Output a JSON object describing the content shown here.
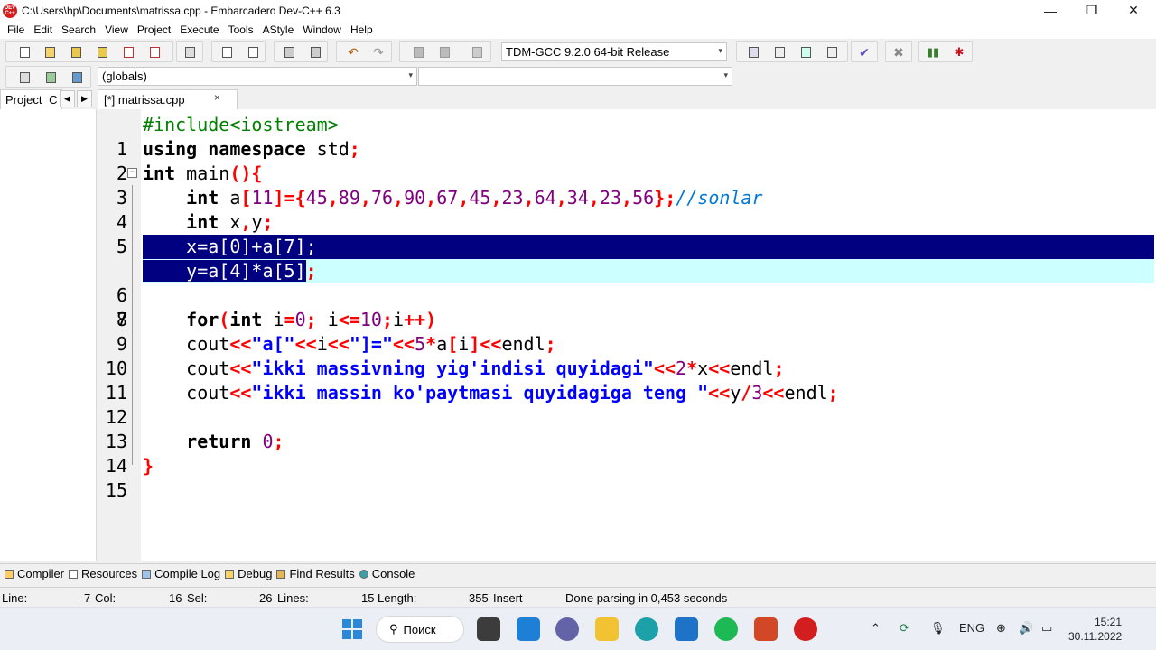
{
  "window": {
    "title": "C:\\Users\\hp\\Documents\\matrissa.cpp - Embarcadero Dev-C++ 6.3",
    "icon_text": "DEV C++",
    "controls": [
      "—",
      "❐",
      "✕"
    ]
  },
  "menu": [
    "File",
    "Edit",
    "Search",
    "View",
    "Project",
    "Execute",
    "Tools",
    "AStyle",
    "Window",
    "Help"
  ],
  "toolbar": {
    "compiler_select": "TDM-GCC 9.2.0 64-bit Release",
    "scope_select": "(globals)",
    "member_select": ""
  },
  "panel": {
    "project_tab": "Project",
    "project_tab_more": "C",
    "file_tab": "[*] matrissa.cpp",
    "close_glyph": "×"
  },
  "editor": {
    "line_numbers": [
      "1",
      "2",
      "3",
      "4",
      "5",
      "6",
      "7",
      "8",
      "9",
      "10",
      "11",
      "12",
      "13",
      "14",
      "15"
    ],
    "fold_glyph": "−"
  },
  "bottom_tabs": [
    "Compiler",
    "Resources",
    "Compile Log",
    "Debug",
    "Find Results",
    "Console"
  ],
  "status": {
    "line_label": "Line:",
    "line_value": "7",
    "col_label": "Col:",
    "col_value": "16",
    "sel_label": "Sel:",
    "sel_value": "26",
    "lines_label": "Lines:",
    "lines_value": "15",
    "length_label": "Length:",
    "length_value": "355",
    "mode": "Insert",
    "message": "Done parsing in 0,453 seconds"
  },
  "taskbar": {
    "search_placeholder": "Поиск",
    "lang": "ENG",
    "time": "15:21",
    "date": "30.11.2022"
  }
}
